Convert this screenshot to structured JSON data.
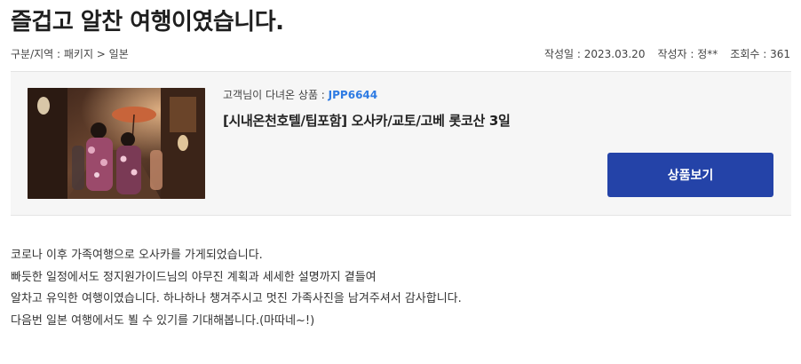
{
  "review": {
    "title": "즐겁고 알찬 여행이였습니다.",
    "category": "구분/지역 : 패키지 > 일본",
    "date": "작성일 : 2023.03.20",
    "author": "작성자 : 정**",
    "views": "조회수 : 361"
  },
  "product": {
    "code_label": "고객님이 다녀온 상품 : ",
    "code": "JPP6644",
    "name": "[시내온천호텔/팁포함] 오사카/교토/고베 롯코산 3일",
    "view_button": "상품보기",
    "image_icon": "kyoto-street-kimono-photo"
  },
  "body_lines": [
    "코로나 이후 가족여행으로 오사카를 가게되었습니다.",
    "빠듯한 일정에서도 정지원가이드님의 야무진 계획과 세세한 설명까지 곁들여",
    "알차고 유익한 여행이였습니다. 하나하나 챙겨주시고 멋진 가족사진을 남겨주셔서 감사합니다.",
    "다음번 일본 여행에서도 뵐 수 있기를 기대해봅니다.(마따네~!)"
  ],
  "colors": {
    "button_bg": "#2443a8",
    "code_accent": "#2e7be3",
    "box_bg": "#f6f6f6"
  }
}
